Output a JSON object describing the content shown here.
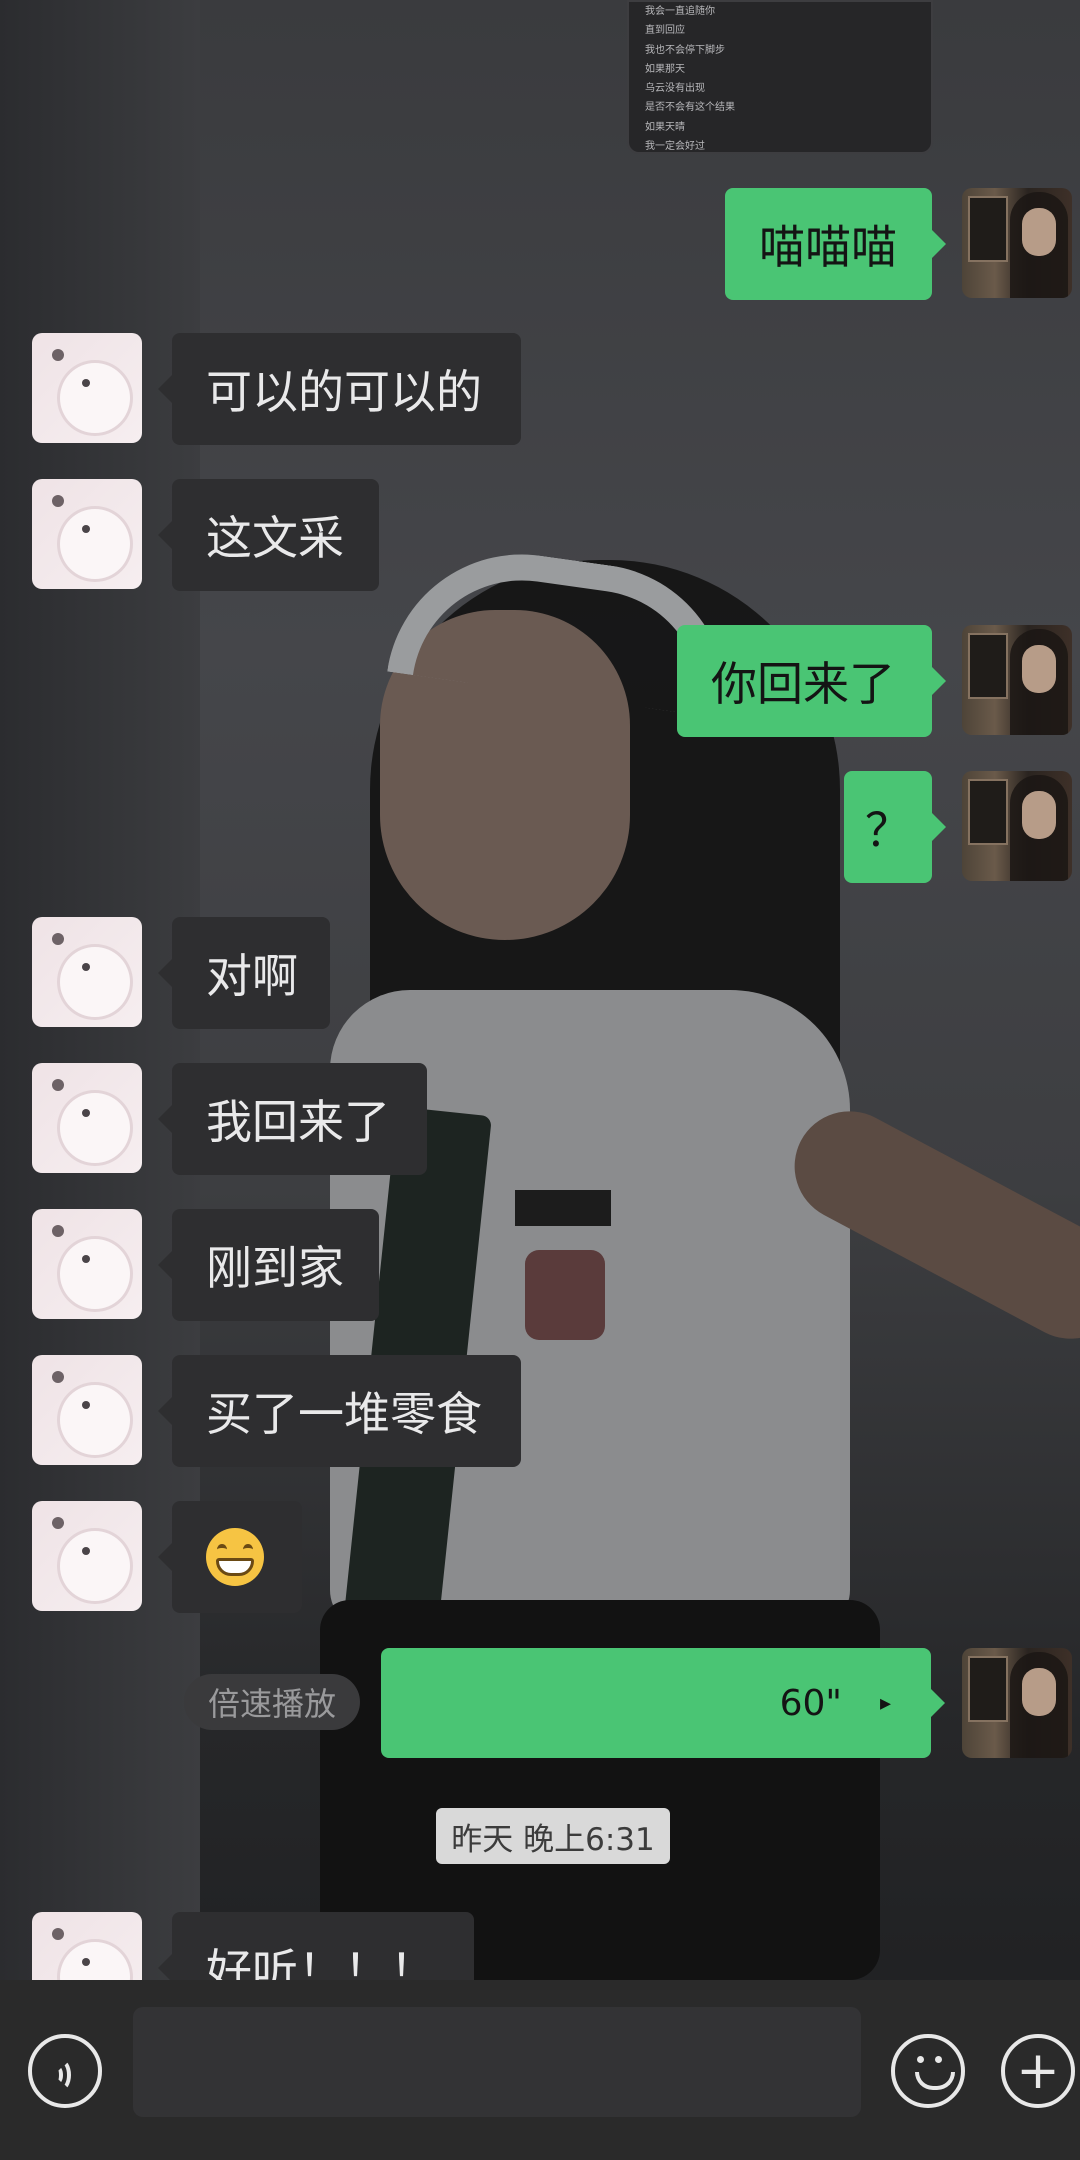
{
  "screenshot_card": {
    "lines": [
      "我会一直追随你",
      "直到回应",
      "我也不会停下脚步",
      "如果那天",
      "乌云没有出现",
      "是否不会有这个结果",
      "如果天晴",
      "我一定会好过"
    ]
  },
  "messages": [
    {
      "side": "self",
      "text": "喵喵喵"
    },
    {
      "side": "other",
      "text": "可以的可以的"
    },
    {
      "side": "other",
      "text": "这文采"
    },
    {
      "side": "self",
      "text": "你回来了"
    },
    {
      "side": "self",
      "text": "？"
    },
    {
      "side": "other",
      "text": "对啊"
    },
    {
      "side": "other",
      "text": "我回来了"
    },
    {
      "side": "other",
      "text": "刚到家"
    },
    {
      "side": "other",
      "text": "买了一堆零食"
    },
    {
      "side": "other",
      "text": "[grinning-emoji]"
    },
    {
      "side": "other",
      "text": "好听！！！"
    }
  ],
  "voice_message": {
    "duration": "60\"",
    "speed_label": "倍速播放"
  },
  "timestamp": "昨天 晚上6:31",
  "input_bar": {
    "placeholder": ""
  },
  "colors": {
    "self_bubble": "#4ac574",
    "other_bubble": "#2e2e30",
    "background": "#2d2e31"
  }
}
